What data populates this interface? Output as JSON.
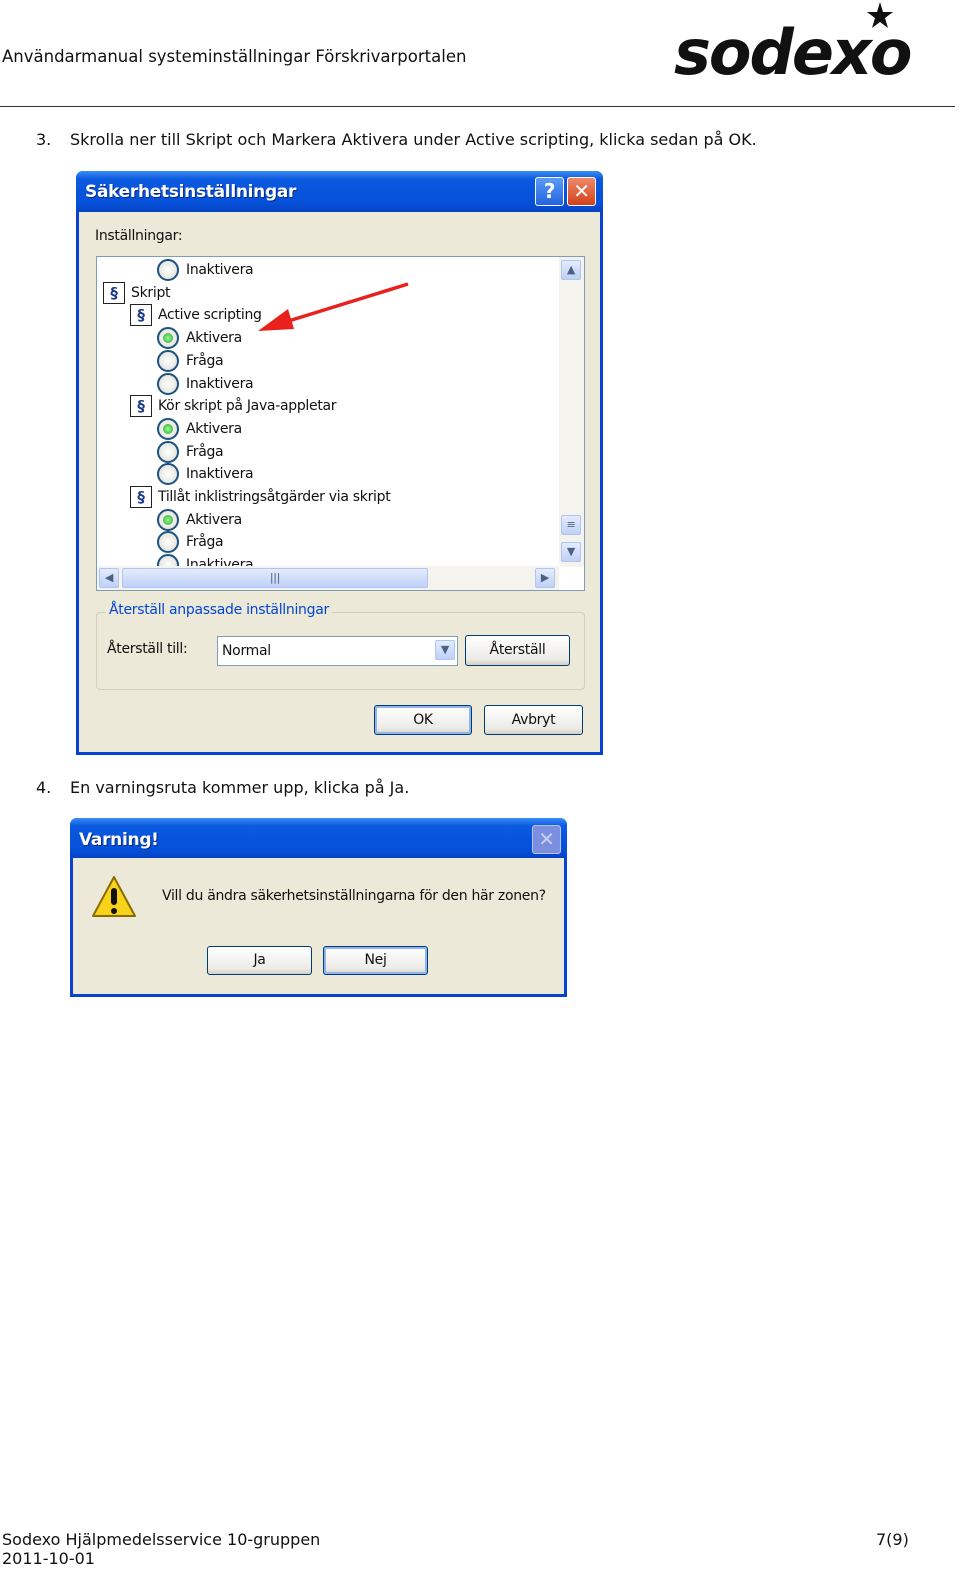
{
  "header": {
    "title": "Användarmanual systeminställningar Förskrivarportalen",
    "logo_text": "sodexo"
  },
  "step3": {
    "number": "3.",
    "text": "Skrolla ner till Skript och Markera Aktivera under Active scripting, klicka sedan på OK."
  },
  "dialog1": {
    "title": "Säkerhetsinställningar",
    "help_label": "?",
    "settings_label": "Inställningar:",
    "tree": [
      {
        "type": "radio",
        "level": 2,
        "label": "Inaktivera",
        "checked": false
      },
      {
        "type": "folder",
        "level": 0,
        "label": "Skript"
      },
      {
        "type": "folder",
        "level": 1,
        "label": "Active scripting"
      },
      {
        "type": "radio",
        "level": 2,
        "label": "Aktivera",
        "checked": true
      },
      {
        "type": "radio",
        "level": 2,
        "label": "Fråga",
        "checked": false
      },
      {
        "type": "radio",
        "level": 2,
        "label": "Inaktivera",
        "checked": false
      },
      {
        "type": "folder",
        "level": 1,
        "label": "Kör skript på Java-appletar"
      },
      {
        "type": "radio",
        "level": 2,
        "label": "Aktivera",
        "checked": true
      },
      {
        "type": "radio",
        "level": 2,
        "label": "Fråga",
        "checked": false
      },
      {
        "type": "radio",
        "level": 2,
        "label": "Inaktivera",
        "checked": false
      },
      {
        "type": "folder",
        "level": 1,
        "label": "Tillåt inklistringsåtgärder via skript"
      },
      {
        "type": "radio",
        "level": 2,
        "label": "Aktivera",
        "checked": true
      },
      {
        "type": "radio",
        "level": 2,
        "label": "Fråga",
        "checked": false
      },
      {
        "type": "radio",
        "level": 2,
        "label": "Inaktivera",
        "checked": false
      }
    ],
    "annotation_arrow_color": "#e8211d",
    "reset_group_label": "Återställ anpassade inställningar",
    "reset_to_label": "Återställ till:",
    "reset_select_value": "Normal",
    "reset_button": "Återställ",
    "ok_button": "OK",
    "cancel_button": "Avbryt"
  },
  "step4": {
    "number": "4.",
    "text": "En varningsruta kommer upp, klicka på Ja."
  },
  "dialog2": {
    "title": "Varning!",
    "message": "Vill du ändra säkerhetsinställningarna för den här zonen?",
    "yes_button": "Ja",
    "no_button": "Nej"
  },
  "footer": {
    "org": "Sodexo Hjälpmedelsservice 10-gruppen",
    "date": "2011-10-01",
    "page": "7(9)"
  },
  "colors": {
    "titlebar": "#0550d8",
    "dialog_bg": "#ece9d8",
    "group_label": "#0046d5"
  }
}
